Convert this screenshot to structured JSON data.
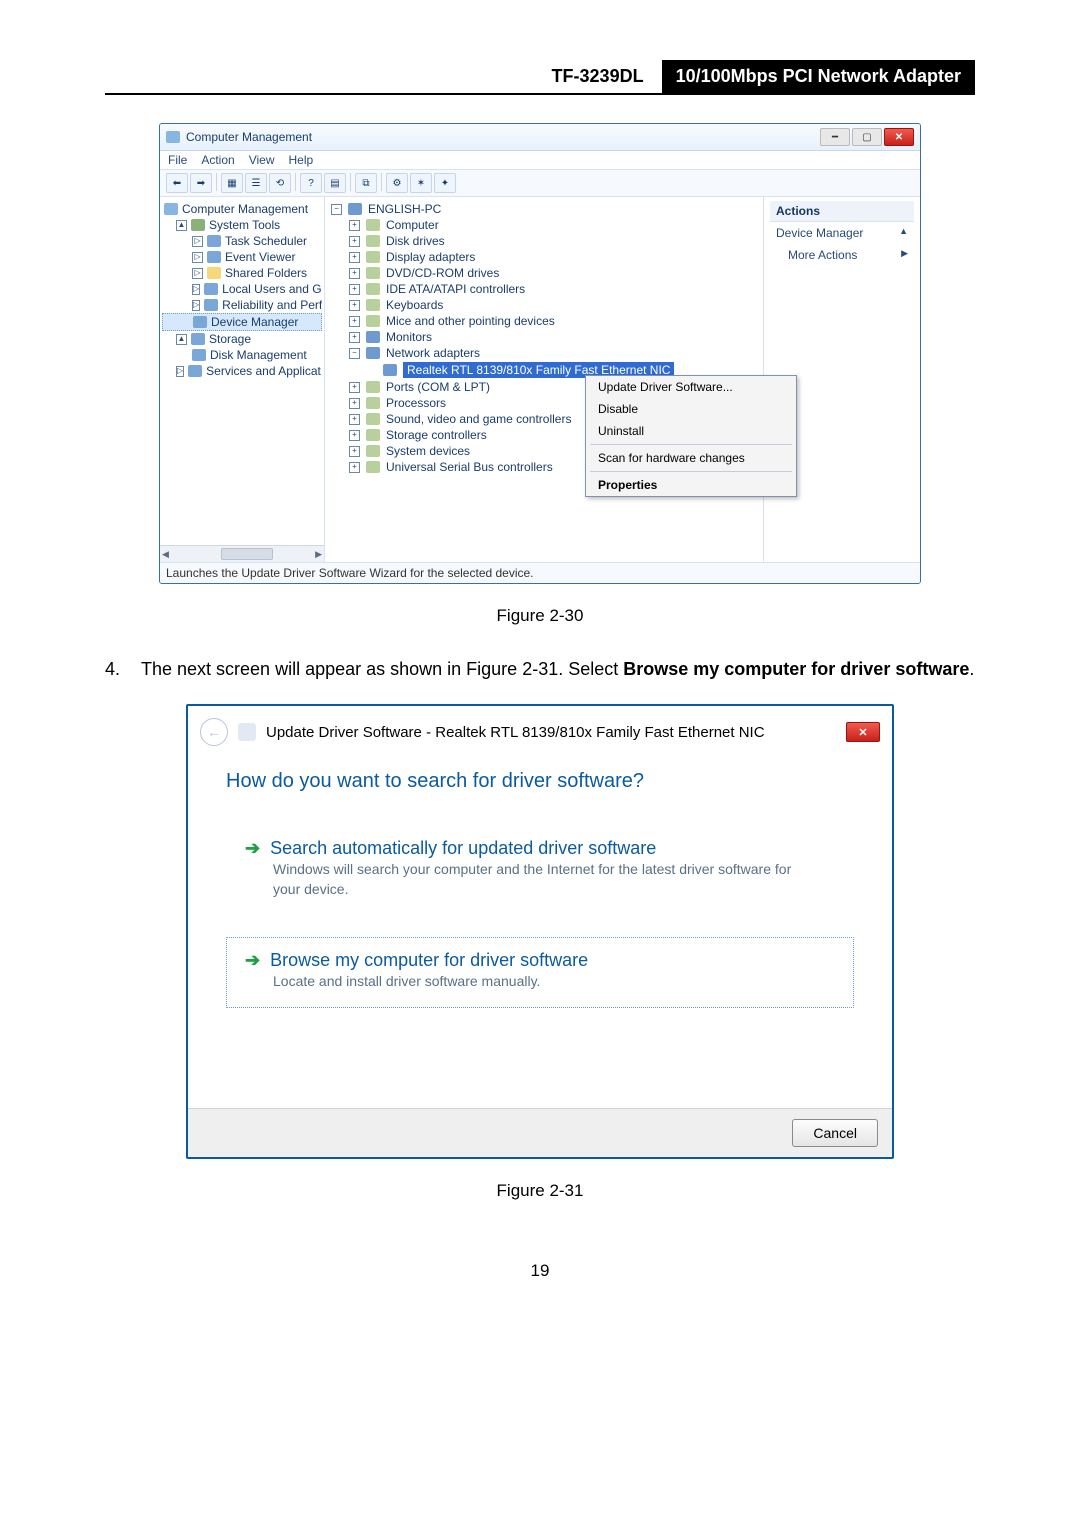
{
  "header": {
    "model": "TF-3239DL",
    "desc": "10/100Mbps PCI Network Adapter"
  },
  "mmc": {
    "title": "Computer Management",
    "menus": [
      "File",
      "Action",
      "View",
      "Help"
    ],
    "left_root": "Computer Management",
    "left_tree": [
      {
        "label": "System Tools",
        "indent": 1,
        "exp": "▲"
      },
      {
        "label": "Task Scheduler",
        "indent": 2,
        "exp": "▷"
      },
      {
        "label": "Event Viewer",
        "indent": 2,
        "exp": "▷"
      },
      {
        "label": "Shared Folders",
        "indent": 2,
        "exp": "▷"
      },
      {
        "label": "Local Users and Gro",
        "indent": 2,
        "exp": "▷"
      },
      {
        "label": "Reliability and Perf",
        "indent": 2,
        "exp": "▷"
      },
      {
        "label": "Device Manager",
        "indent": 2,
        "exp": "",
        "selected": true
      },
      {
        "label": "Storage",
        "indent": 1,
        "exp": "▲"
      },
      {
        "label": "Disk Management",
        "indent": 2,
        "exp": ""
      },
      {
        "label": "Services and Applicat",
        "indent": 1,
        "exp": "▷"
      }
    ],
    "device_root": "ENGLISH-PC",
    "devices": [
      {
        "label": "Computer",
        "exp": "+"
      },
      {
        "label": "Disk drives",
        "exp": "+"
      },
      {
        "label": "Display adapters",
        "exp": "+"
      },
      {
        "label": "DVD/CD-ROM drives",
        "exp": "+"
      },
      {
        "label": "IDE ATA/ATAPI controllers",
        "exp": "+"
      },
      {
        "label": "Keyboards",
        "exp": "+"
      },
      {
        "label": "Mice and other pointing devices",
        "exp": "+"
      },
      {
        "label": "Monitors",
        "exp": "+"
      },
      {
        "label": "Network adapters",
        "exp": "−"
      }
    ],
    "selected_device": "Realtek RTL 8139/810x Family Fast Ethernet NIC",
    "devices_after": [
      {
        "label": "Ports (COM & LPT)",
        "exp": "+"
      },
      {
        "label": "Processors",
        "exp": "+"
      },
      {
        "label": "Sound, video and game controllers",
        "exp": "+"
      },
      {
        "label": "Storage controllers",
        "exp": "+"
      },
      {
        "label": "System devices",
        "exp": "+"
      },
      {
        "label": "Universal Serial Bus controllers",
        "exp": "+"
      }
    ],
    "context_menu": {
      "items": [
        "Update Driver Software...",
        "Disable",
        "Uninstall"
      ],
      "mid": [
        "Scan for hardware changes"
      ],
      "bottom": "Properties"
    },
    "actions_pane": {
      "header": "Actions",
      "rows": [
        "Device Manager",
        "More Actions"
      ]
    },
    "statusbar": "Launches the Update Driver Software Wizard for the selected device."
  },
  "caption1": "Figure 2-30",
  "step": {
    "num": "4.",
    "text_before": "The next screen will appear as shown in Figure 2-31. Select ",
    "text_bold": "Browse my computer for driver software",
    "text_after": "."
  },
  "wizard": {
    "title_prefix": "Update Driver Software - ",
    "title_device": "Realtek RTL 8139/810x Family Fast Ethernet NIC",
    "heading": "How do you want to search for driver software?",
    "opt1": {
      "title": "Search automatically for updated driver software",
      "sub": "Windows will search your computer and the Internet for the latest driver software for your device."
    },
    "opt2": {
      "title": "Browse my computer for driver software",
      "sub": "Locate and install driver software manually."
    },
    "cancel": "Cancel"
  },
  "caption2": "Figure 2-31",
  "page_number": "19"
}
